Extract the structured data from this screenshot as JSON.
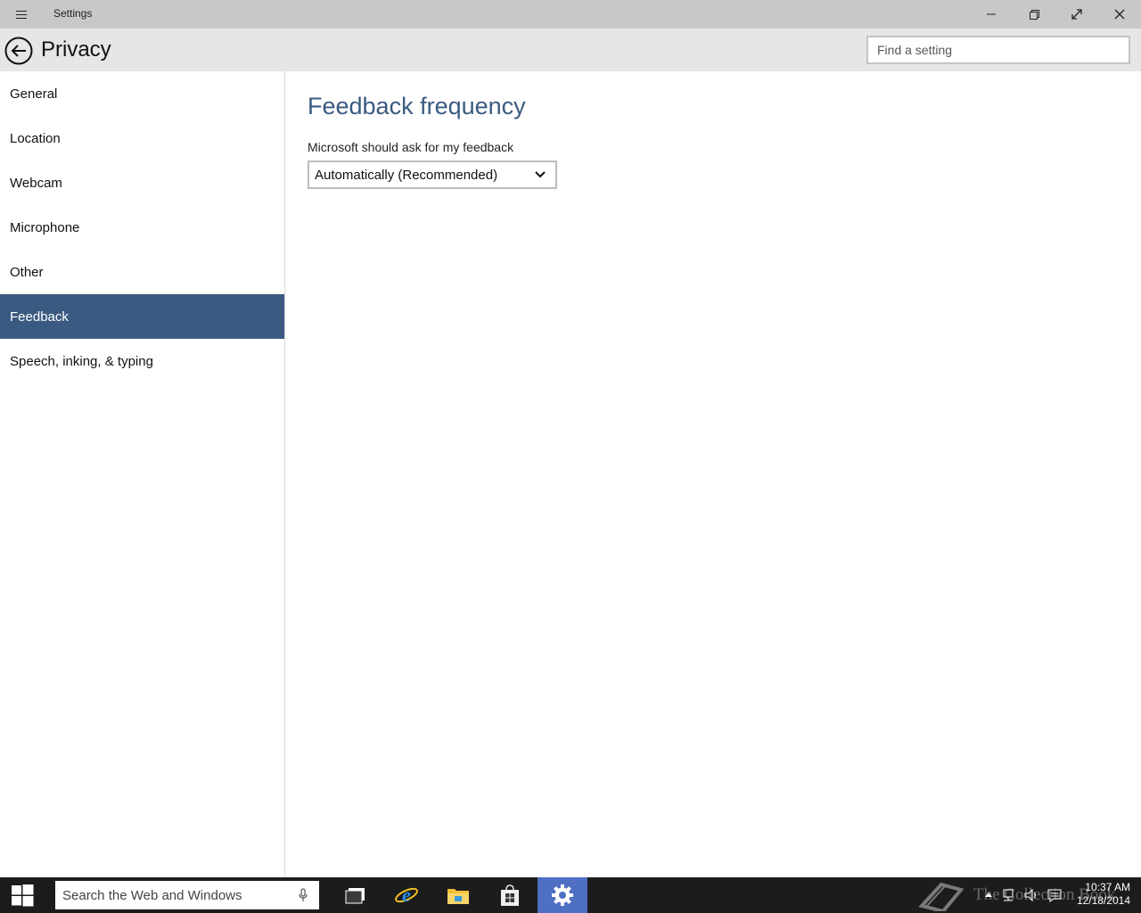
{
  "window": {
    "title": "Settings"
  },
  "header": {
    "title": "Privacy",
    "search_placeholder": "Find a setting"
  },
  "sidebar": {
    "items": [
      {
        "label": "General"
      },
      {
        "label": "Location"
      },
      {
        "label": "Webcam"
      },
      {
        "label": "Microphone"
      },
      {
        "label": "Other"
      },
      {
        "label": "Feedback",
        "selected": true
      },
      {
        "label": "Speech, inking, & typing"
      }
    ]
  },
  "main": {
    "section_title": "Feedback frequency",
    "feedback_label": "Microsoft should ask for my feedback",
    "feedback_value": "Automatically (Recommended)"
  },
  "taskbar": {
    "search_placeholder": "Search the Web and Windows",
    "apps": [
      "task-view",
      "internet-explorer",
      "file-explorer",
      "store",
      "settings"
    ],
    "active_app": "settings",
    "watermark": "The Collection Book",
    "time": "10:37 AM",
    "date": "12/18/2014"
  },
  "colors": {
    "titlebar": "#c8c8c8",
    "header": "#e6e6e6",
    "accent": "#3b5a82",
    "section_title": "#3a5a80",
    "taskbar": "#1c1c1c",
    "taskbar_active": "#4f6fc3"
  }
}
